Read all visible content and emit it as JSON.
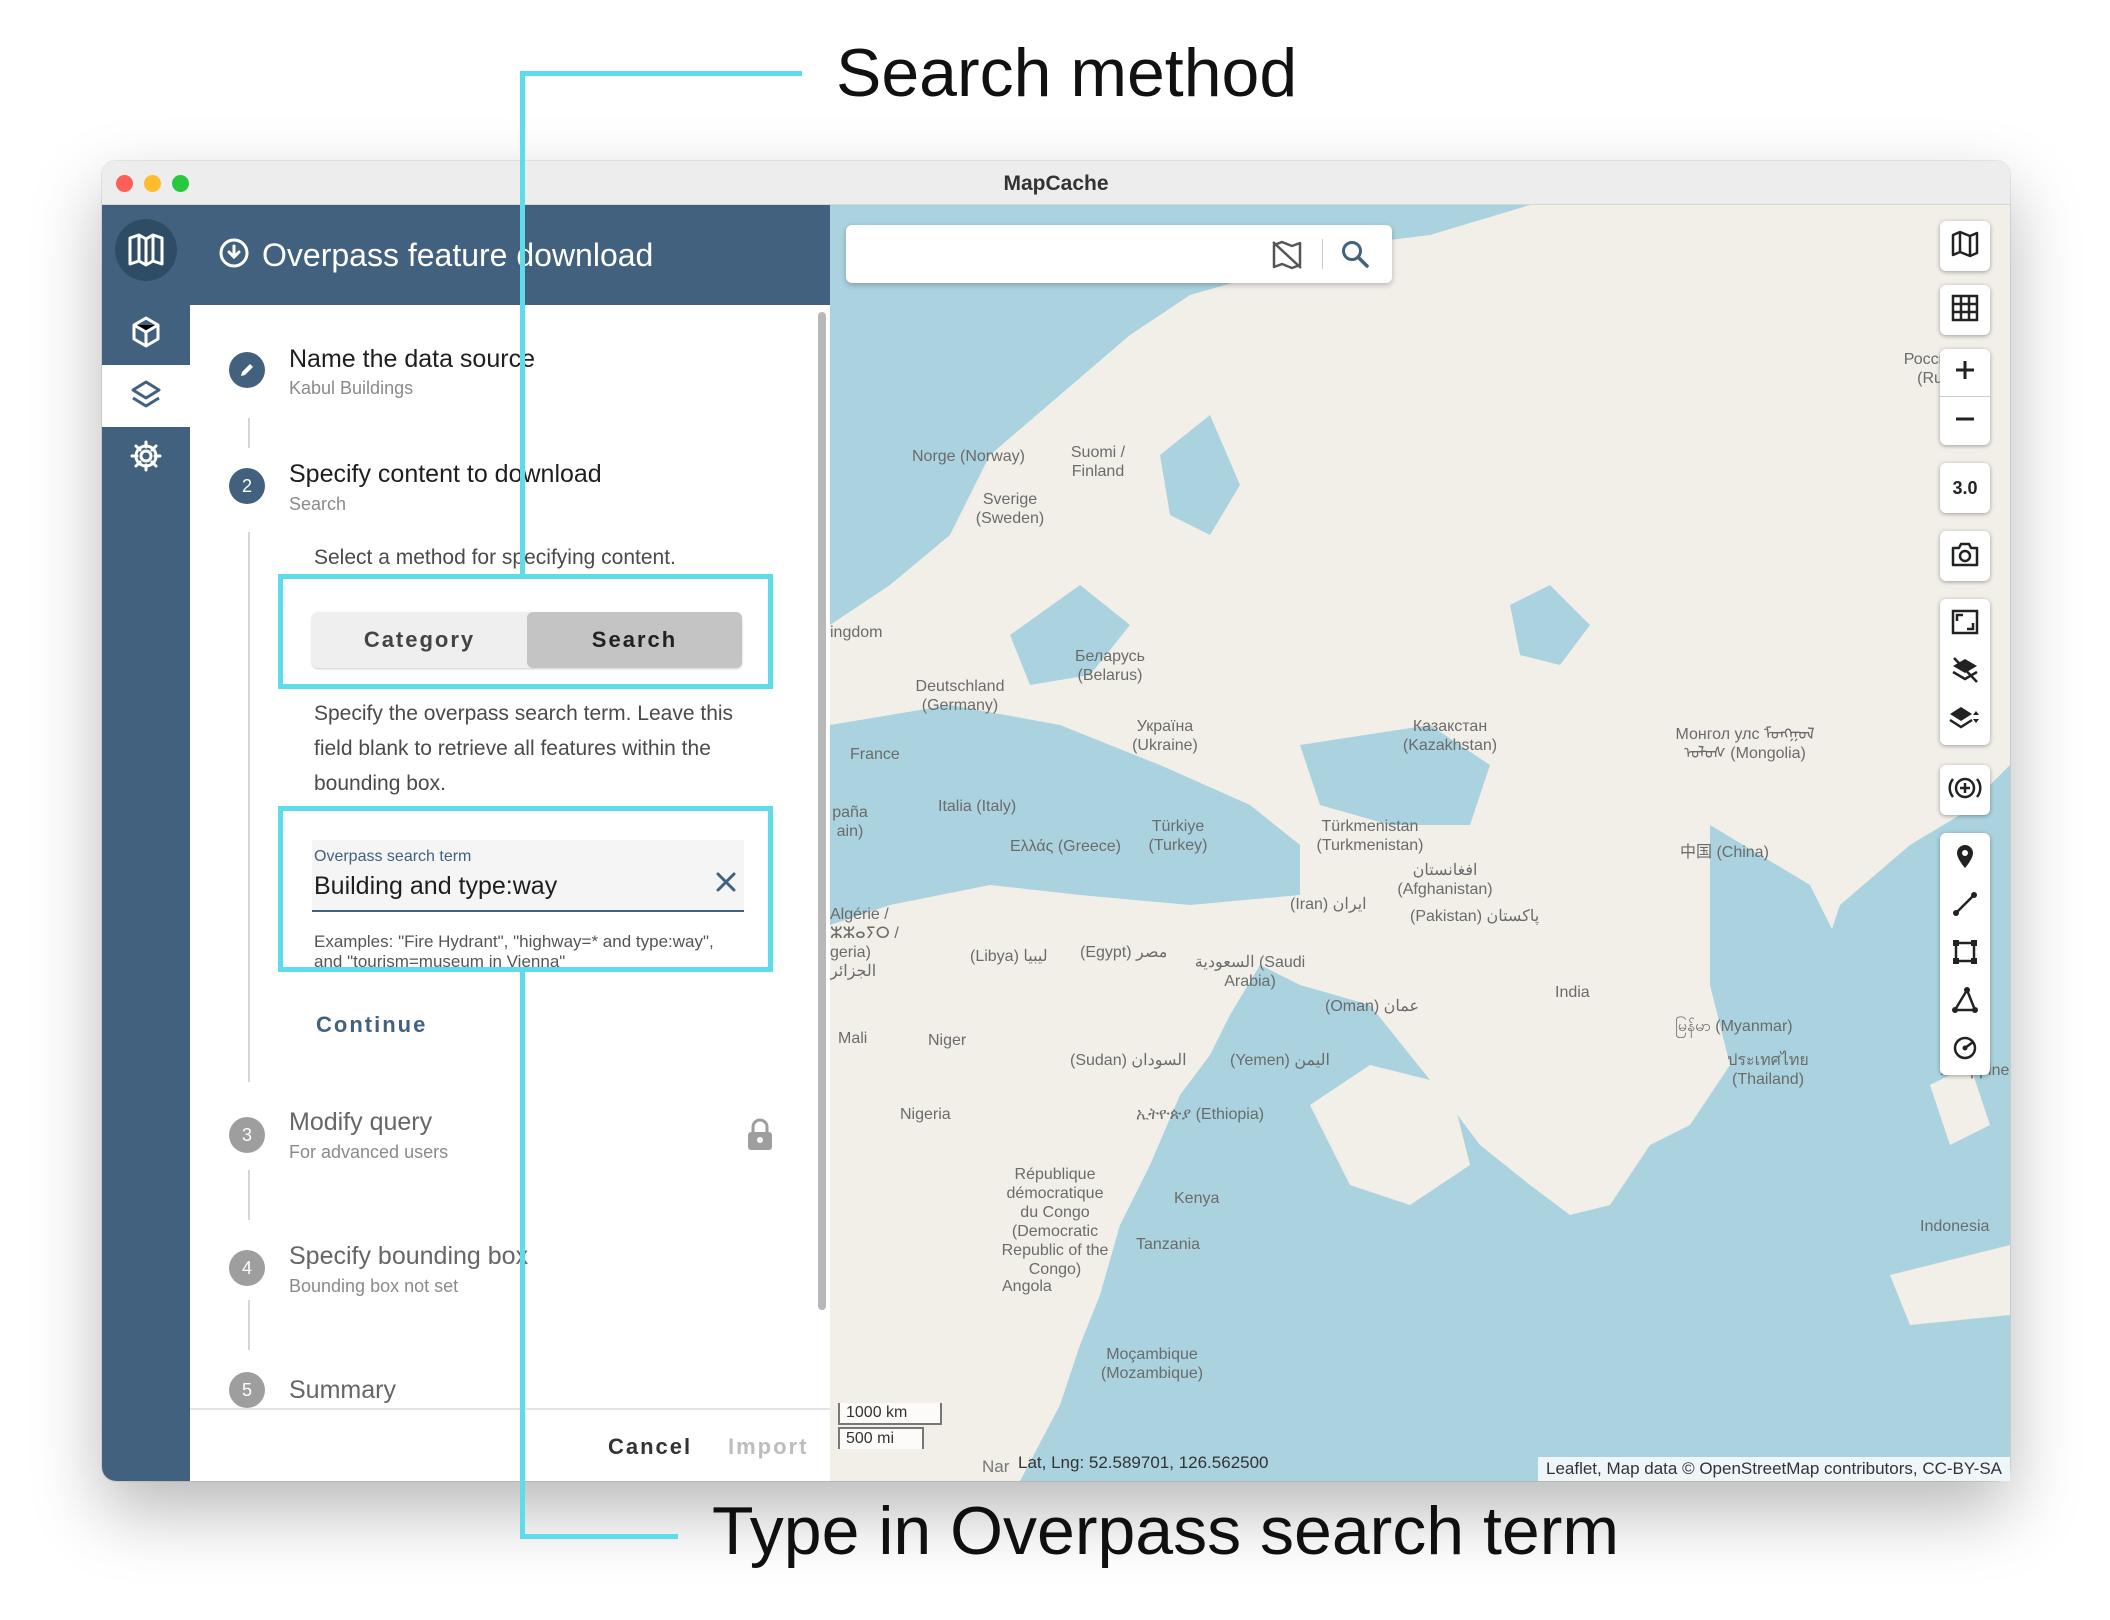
{
  "annotations": {
    "top": "Search method",
    "bottom": "Type in Overpass search term"
  },
  "window": {
    "title": "MapCache"
  },
  "panel": {
    "header_title": "Overpass feature download",
    "steps": [
      {
        "number": "1",
        "title": "Name the data source",
        "subtitle": "Kabul Buildings"
      },
      {
        "number": "2",
        "title": "Specify content to download",
        "subtitle": "Search"
      },
      {
        "number": "3",
        "title": "Modify query",
        "subtitle": "For advanced users"
      },
      {
        "number": "4",
        "title": "Specify bounding box",
        "subtitle": "Bounding box not set"
      },
      {
        "number": "5",
        "title": "Summary",
        "subtitle": ""
      }
    ],
    "method_prompt": "Select a method for specifying content.",
    "method_options": [
      "Category",
      "Search"
    ],
    "method_selected": "Search",
    "search_help": "Specify the overpass search term. Leave this field blank to retrieve all features within the bounding box.",
    "search_field": {
      "label": "Overpass search term",
      "value": "Building and type:way",
      "hint": "Examples: \"Fire Hydrant\", \"highway=* and type:way\", and \"tourism=museum in Vienna\""
    },
    "continue_label": "Continue",
    "cancel_label": "Cancel",
    "import_label": "Import"
  },
  "map": {
    "zoom": "3.0",
    "scale_km": "1000 km",
    "scale_mi": "500 mi",
    "coords": "Lat, Lng: 52.589701, 126.562500",
    "coords_prefix": "Nar",
    "attribution": "Leaflet, Map data © OpenStreetMap contributors, CC-BY-SA",
    "labels": {
      "norway": "Norge (Norway)",
      "finland": "Suomi / Finland",
      "sweden": "Sverige (Sweden)",
      "russia": "Россия (Ru",
      "kingdom": "ingdom",
      "belarus": "Беларусь (Belarus)",
      "germany": "Deutschland (Germany)",
      "ukraine": "Україна (Ukraine)",
      "kazakhstan": "Казакстан (Kazakhstan)",
      "mongolia": "Монгол улс ᠮᠣᠩᠭᠣᠯ ᠤᠯᠤᠰ (Mongolia)",
      "france": "France",
      "spain": "paña ain)",
      "italy": "Italia (Italy)",
      "greece": "Ελλάς (Greece)",
      "turkey": "Türkiye (Turkey)",
      "turkmenistan": "Türkmenistan (Turkmenistan)",
      "china": "中国 (China)",
      "afghanistan": "افغانستان (Afghanistan)",
      "iran": "(Iran) ایران",
      "pakistan": "(Pakistan) پاکستان",
      "algeria": "Algérie / ⵣⵣⴰⵢⵔ / geria) الجزائر",
      "libya": "(Libya) ليبيا",
      "egypt": "(Egypt) مصر",
      "saudi": "السعودية (Saudi Arabia)",
      "oman": "(Oman) عمان",
      "india": "India",
      "myanmar": "မြန်မာ (Myanmar)",
      "thailand": "ประเทศไทย (Thailand)",
      "philippines": "Philippines",
      "mali": "Mali",
      "niger": "Niger",
      "sudan": "(Sudan) السودان",
      "yemen": "(Yemen) اليمن",
      "nigeria": "Nigeria",
      "ethiopia": "ኢትዮጵያ (Ethiopia)",
      "drc": "République démocratique du Congo (Democratic Republic of the Congo)",
      "kenya": "Kenya",
      "tanzania": "Tanzania",
      "angola": "Angola",
      "mozambique": "Moçambique (Mozambique)",
      "indonesia": "Indonesia"
    }
  }
}
